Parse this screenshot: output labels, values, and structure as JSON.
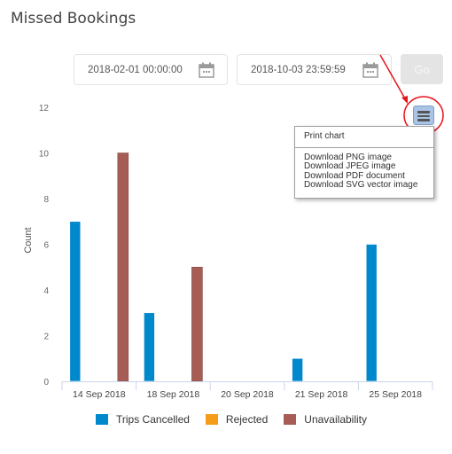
{
  "page": {
    "title": "Missed Bookings"
  },
  "filters": {
    "start_date": "2018-02-01 00:00:00",
    "end_date": "2018-10-03 23:59:59",
    "go_label": "Go",
    "calendar_icon": "calendar-icon"
  },
  "export_menu": {
    "button_icon": "hamburger-menu-icon",
    "items": [
      "Print chart",
      "Download PNG image",
      "Download JPEG image",
      "Download PDF document",
      "Download SVG vector image"
    ]
  },
  "annotation": {
    "color": "#e8141a",
    "description": "red arrow and circle pointing to chart menu button"
  },
  "chart_data": {
    "type": "bar",
    "title": "",
    "xlabel": "",
    "ylabel": "Count",
    "ylim": [
      0,
      12
    ],
    "yticks": [
      0,
      2,
      4,
      6,
      8,
      10,
      12
    ],
    "grid": false,
    "legend_position": "bottom",
    "categories": [
      "14 Sep 2018",
      "18 Sep 2018",
      "20 Sep 2018",
      "21 Sep 2018",
      "25 Sep 2018"
    ],
    "series": [
      {
        "name": "Trips Cancelled",
        "color": "#0088cc",
        "values": [
          7,
          3,
          0,
          1,
          6
        ]
      },
      {
        "name": "Rejected",
        "color": "#f59c1a",
        "values": [
          0,
          0,
          0,
          0,
          0
        ]
      },
      {
        "name": "Unavailability",
        "color": "#a55d55",
        "values": [
          10,
          5,
          0,
          0,
          0
        ]
      }
    ]
  }
}
